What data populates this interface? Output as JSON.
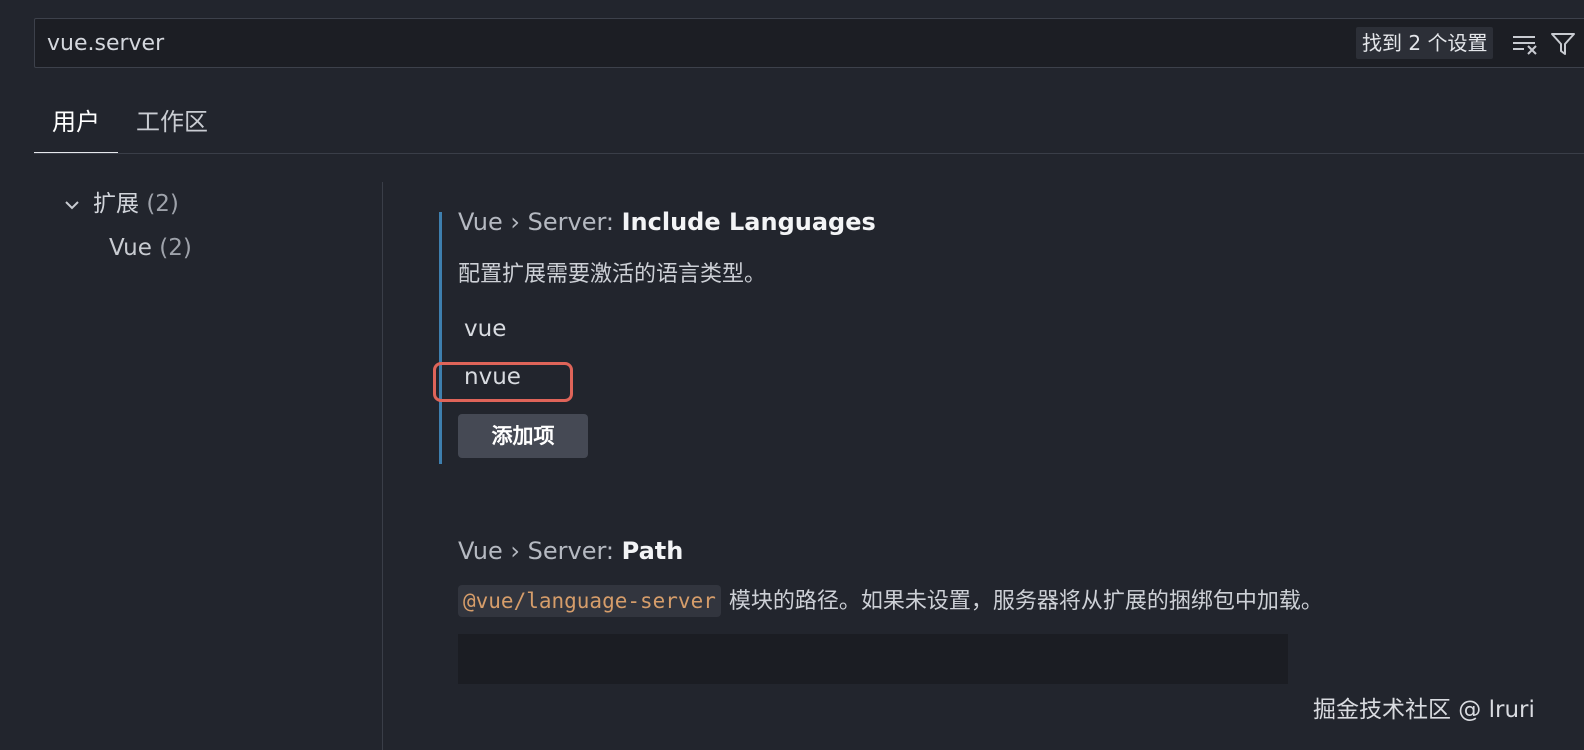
{
  "search": {
    "value": "vue.server",
    "result_count": "找到 2 个设置"
  },
  "tabs": [
    {
      "label": "用户",
      "active": true
    },
    {
      "label": "工作区",
      "active": false
    }
  ],
  "toc": {
    "group_label": "扩展",
    "group_count": "(2)",
    "item_label": "Vue",
    "item_count": "(2)"
  },
  "settings": {
    "include_languages": {
      "category": "Vue › Server: ",
      "name": "Include Languages",
      "description": "配置扩展需要激活的语言类型。",
      "items": [
        "vue",
        "nvue"
      ],
      "add_button": "添加项"
    },
    "path": {
      "category": "Vue › Server: ",
      "name": "Path",
      "code": "@vue/language-server",
      "description": "模块的路径。如果未设置，服务器将从扩展的捆绑包中加载。",
      "value": ""
    }
  },
  "watermark": "掘金技术社区 @ lruri",
  "colors": {
    "background": "#22252d",
    "accent_border": "#3e7fae",
    "highlight_border": "#df6459"
  }
}
